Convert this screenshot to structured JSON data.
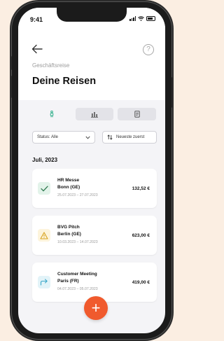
{
  "status_bar": {
    "time": "9:41"
  },
  "header": {
    "back_icon": "arrow-left-icon",
    "help_icon": "question-circle-icon",
    "help_glyph": "?",
    "eyebrow": "Geschäftsreise",
    "title": "Deine Reisen"
  },
  "tabs": [
    {
      "icon": "walking-person-icon",
      "active": true
    },
    {
      "icon": "bar-chart-icon",
      "active": false
    },
    {
      "icon": "document-icon",
      "active": false
    }
  ],
  "filters": {
    "status_label": "Status: Alle",
    "sort_label": "Neueste zuerst"
  },
  "section": {
    "title": "Juli, 2023"
  },
  "trips": [
    {
      "title": "HR Messe",
      "city": "Bonn (GE)",
      "dates": "25.07.2023 – 27.07.2023",
      "amount": "132,52 €",
      "icon": "checkmark-icon",
      "icon_color": "#2f7a4f",
      "icon_bg": "#e3f3ea"
    },
    {
      "title": "BVG Pitch",
      "city": "Berlin (GE)",
      "dates": "10.03.2023 – 14.07.2023",
      "amount": "623,00 €",
      "icon": "warning-icon",
      "icon_color": "#d7a21d",
      "icon_bg": "#fdf4dc"
    },
    {
      "title": "Customer Meeting",
      "city": "Paris (FR)",
      "dates": "04.07.2023 – 05.07.2023",
      "amount": "419,00 €",
      "icon": "share-arrow-icon",
      "icon_color": "#3aa7c9",
      "icon_bg": "#e2f3f8"
    }
  ],
  "fab": {
    "icon": "plus-icon",
    "glyph": "+"
  },
  "colors": {
    "accent": "#f05a2d",
    "background": "#fbeee2",
    "screen": "#f4f4f7"
  }
}
